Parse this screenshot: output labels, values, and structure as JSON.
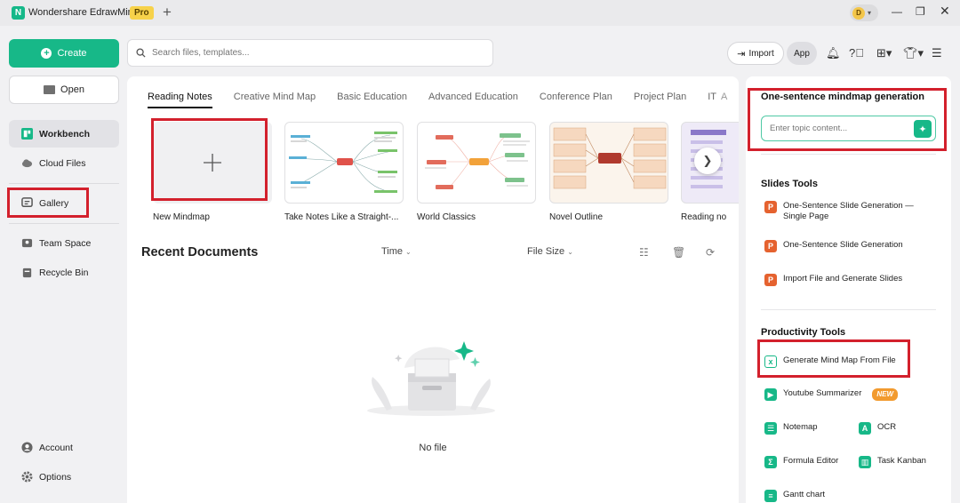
{
  "titlebar": {
    "app_name": "Wondershare EdrawMind",
    "badge": "Pro",
    "avatar_letter": "D"
  },
  "sidebar": {
    "create_label": "Create",
    "open_label": "Open",
    "items": [
      {
        "label": "Workbench",
        "icon": "workbench-icon"
      },
      {
        "label": "Cloud Files",
        "icon": "cloud-icon"
      },
      {
        "label": "Gallery",
        "icon": "gallery-icon"
      },
      {
        "label": "Team Space",
        "icon": "team-icon"
      },
      {
        "label": "Recycle Bin",
        "icon": "recycle-bin-icon"
      }
    ],
    "bottom": [
      {
        "label": "Account",
        "icon": "account-icon"
      },
      {
        "label": "Options",
        "icon": "options-icon"
      }
    ]
  },
  "toolbar": {
    "search_placeholder": "Search files, templates...",
    "import_label": "Import",
    "app_label": "App"
  },
  "tabs": [
    "Reading Notes",
    "Creative Mind Map",
    "Basic Education",
    "Advanced Education",
    "Conference Plan",
    "Project Plan",
    "IT",
    "A"
  ],
  "templates": [
    {
      "label": "New Mindmap"
    },
    {
      "label": "Take Notes Like a Straight-..."
    },
    {
      "label": "World Classics"
    },
    {
      "label": "Novel Outline"
    },
    {
      "label": "Reading no"
    }
  ],
  "recent": {
    "title": "Recent Documents",
    "sort_time": "Time",
    "sort_size": "File Size",
    "empty_text": "No file"
  },
  "right_panel": {
    "generation_title": "One-sentence mindmap generation",
    "topic_placeholder": "Enter topic content...",
    "slides_title": "Slides Tools",
    "slides_tools": [
      {
        "line1": "One-Sentence Slide Generation —",
        "line2": "Single Page"
      },
      {
        "line1": "One-Sentence Slide Generation",
        "line2": ""
      },
      {
        "line1": "Import File and Generate Slides",
        "line2": ""
      }
    ],
    "productivity_title": "Productivity Tools",
    "productivity_tools": [
      {
        "label": "Generate Mind Map From File"
      },
      {
        "label": "Youtube Summarizer",
        "badge": "NEW"
      },
      {
        "label": "Notemap"
      },
      {
        "label": "OCR"
      },
      {
        "label": "Formula Editor"
      },
      {
        "label": "Task Kanban"
      },
      {
        "label": "Gantt chart"
      }
    ]
  },
  "colors": {
    "brand_green": "#17b888",
    "highlight_red": "#d3202c",
    "pro_badge": "#f7d24a",
    "slides_orange": "#e5622f"
  }
}
